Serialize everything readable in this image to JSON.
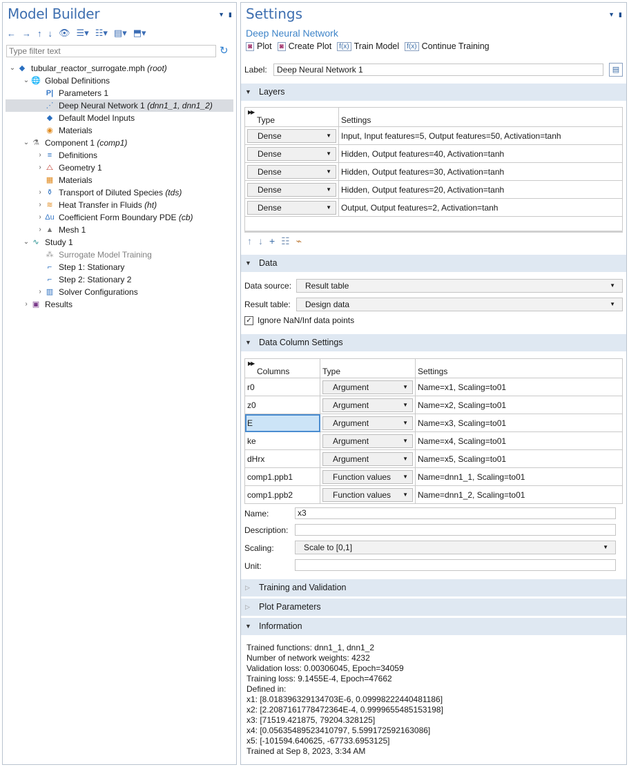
{
  "left": {
    "title": "Model Builder",
    "filter_placeholder": "Type filter text",
    "tree": [
      {
        "label": "tubular_reactor_surrogate.mph",
        "tag": "(root)"
      },
      {
        "label": "Global Definitions"
      },
      {
        "label": "Parameters 1"
      },
      {
        "label": "Deep Neural Network 1",
        "tag": "(dnn1_1, dnn1_2)"
      },
      {
        "label": "Default Model Inputs"
      },
      {
        "label": "Materials"
      },
      {
        "label": "Component 1",
        "tag": "(comp1)"
      },
      {
        "label": "Definitions"
      },
      {
        "label": "Geometry 1"
      },
      {
        "label": "Materials"
      },
      {
        "label": "Transport of Diluted Species",
        "tag": "(tds)"
      },
      {
        "label": "Heat Transfer in Fluids",
        "tag": "(ht)"
      },
      {
        "label": "Coefficient Form Boundary PDE",
        "tag": "(cb)"
      },
      {
        "label": "Mesh 1"
      },
      {
        "label": "Study 1"
      },
      {
        "label": "Surrogate Model Training"
      },
      {
        "label": "Step 1: Stationary"
      },
      {
        "label": "Step 2: Stationary 2"
      },
      {
        "label": "Solver Configurations"
      },
      {
        "label": "Results"
      }
    ]
  },
  "right": {
    "title": "Settings",
    "subtitle": "Deep Neural Network",
    "toolbar": [
      "Plot",
      "Create Plot",
      "Train Model",
      "Continue Training"
    ],
    "label_caption": "Label:",
    "label_value": "Deep Neural Network 1",
    "sections": {
      "layers": "Layers",
      "data": "Data",
      "data_columns": "Data Column Settings",
      "training": "Training and Validation",
      "plot_params": "Plot Parameters",
      "information": "Information"
    },
    "layers_table": {
      "headers": [
        "Type",
        "Settings"
      ],
      "rows": [
        {
          "type": "Dense",
          "settings": "Input, Input features=5, Output features=50, Activation=tanh"
        },
        {
          "type": "Dense",
          "settings": "Hidden, Output features=40, Activation=tanh"
        },
        {
          "type": "Dense",
          "settings": "Hidden, Output features=30, Activation=tanh"
        },
        {
          "type": "Dense",
          "settings": "Hidden, Output features=20, Activation=tanh"
        },
        {
          "type": "Dense",
          "settings": "Output, Output features=2, Activation=tanh"
        }
      ]
    },
    "data": {
      "source_label": "Data source:",
      "source_value": "Result table",
      "table_label": "Result table:",
      "table_value": "Design data",
      "ignore_nan_label": "Ignore NaN/Inf data points",
      "ignore_nan_checked": true
    },
    "columns_table": {
      "headers": [
        "Columns",
        "Type",
        "Settings"
      ],
      "rows": [
        {
          "col": "r0",
          "type": "Argument",
          "settings": "Name=x1, Scaling=to01"
        },
        {
          "col": "z0",
          "type": "Argument",
          "settings": "Name=x2, Scaling=to01"
        },
        {
          "col": "E",
          "type": "Argument",
          "settings": "Name=x3, Scaling=to01"
        },
        {
          "col": "ke",
          "type": "Argument",
          "settings": "Name=x4, Scaling=to01"
        },
        {
          "col": "dHrx",
          "type": "Argument",
          "settings": "Name=x5, Scaling=to01"
        },
        {
          "col": "comp1.ppb1",
          "type": "Function values",
          "settings": "Name=dnn1_1, Scaling=to01"
        },
        {
          "col": "comp1.ppb2",
          "type": "Function values",
          "settings": "Name=dnn1_2, Scaling=to01"
        }
      ]
    },
    "column_fields": {
      "name_label": "Name:",
      "name_value": "x3",
      "description_label": "Description:",
      "description_value": "",
      "scaling_label": "Scaling:",
      "scaling_value": "Scale to [0,1]",
      "unit_label": "Unit:",
      "unit_value": ""
    },
    "information": [
      "Trained functions: dnn1_1, dnn1_2",
      "Number of network weights: 4232",
      "Validation loss: 0.00306045, Epoch=34059",
      "Training loss: 9.1455E-4, Epoch=47662",
      "Defined in:",
      "x1: [8.018396329134703E-6, 0.09998222440481186]",
      "x2: [2.2087161778472364E-4, 0.9999655485153198]",
      "x3: [71519.421875, 79204.328125]",
      "x4: [0.05635489523410797, 5.599172592163086]",
      "x5: [-101594.640625, -67733.6953125]",
      "Trained at Sep 8, 2023, 3:34 AM"
    ]
  }
}
